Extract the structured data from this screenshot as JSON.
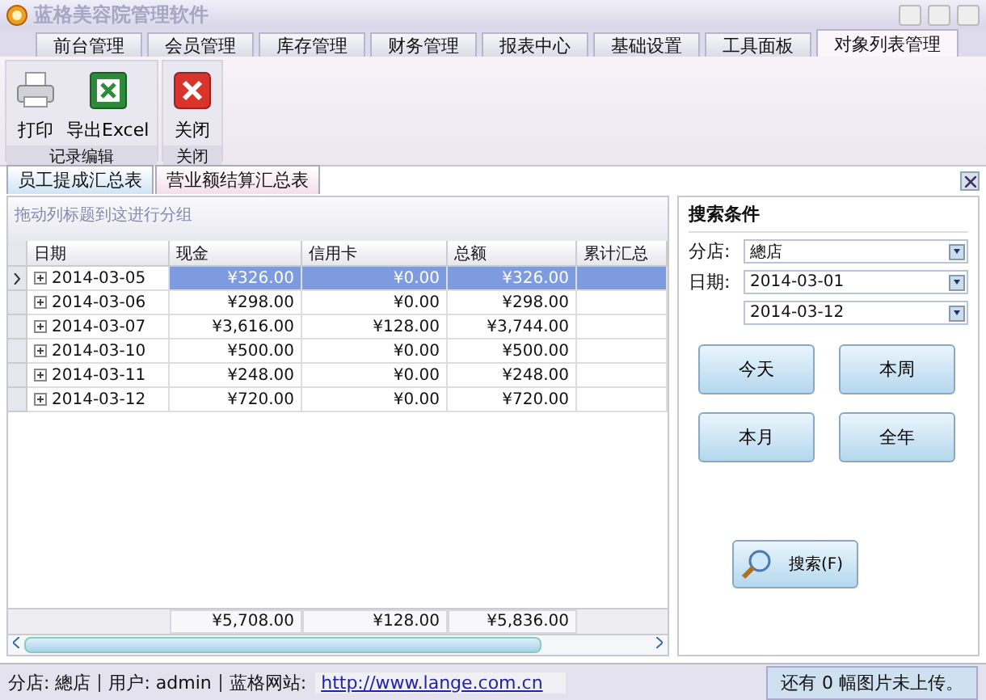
{
  "window": {
    "title": "蓝格美容院管理软件"
  },
  "menu_tabs": [
    {
      "label": "前台管理",
      "selected": false
    },
    {
      "label": "会员管理",
      "selected": false
    },
    {
      "label": "库存管理",
      "selected": false
    },
    {
      "label": "财务管理",
      "selected": false
    },
    {
      "label": "报表中心",
      "selected": false
    },
    {
      "label": "基础设置",
      "selected": false
    },
    {
      "label": "工具面板",
      "selected": false
    },
    {
      "label": "对象列表管理",
      "selected": true
    }
  ],
  "ribbon_groups": [
    {
      "label": "记录编辑",
      "buttons": [
        {
          "label": "打印",
          "kind": "print"
        },
        {
          "label": "导出Excel",
          "kind": "excel"
        }
      ]
    },
    {
      "label": "关闭",
      "buttons": [
        {
          "label": "关闭",
          "kind": "close"
        }
      ]
    }
  ],
  "doc_tabs": [
    {
      "label": "员工提成汇总表",
      "selected": false
    },
    {
      "label": "营业额结算汇总表",
      "selected": true
    }
  ],
  "group_panel": {
    "hint": "拖动列标题到这进行分组"
  },
  "table": {
    "columns": [
      "日期",
      "现金",
      "信用卡",
      "总额",
      "累计汇总"
    ],
    "rows": [
      {
        "cells": [
          "2014-03-05",
          "¥326.00",
          "¥0.00",
          "¥326.00",
          ""
        ],
        "selected": true
      },
      {
        "cells": [
          "2014-03-06",
          "¥298.00",
          "¥0.00",
          "¥298.00",
          ""
        ],
        "selected": false
      },
      {
        "cells": [
          "2014-03-07",
          "¥3,616.00",
          "¥128.00",
          "¥3,744.00",
          ""
        ],
        "selected": false
      },
      {
        "cells": [
          "2014-03-10",
          "¥500.00",
          "¥0.00",
          "¥500.00",
          ""
        ],
        "selected": false
      },
      {
        "cells": [
          "2014-03-11",
          "¥248.00",
          "¥0.00",
          "¥248.00",
          ""
        ],
        "selected": false
      },
      {
        "cells": [
          "2014-03-12",
          "¥720.00",
          "¥0.00",
          "¥720.00",
          ""
        ],
        "selected": false
      }
    ],
    "totals": [
      "¥5,708.00",
      "¥128.00",
      "¥5,836.00"
    ]
  },
  "search": {
    "title": "搜索条件",
    "store_label": "分店:",
    "store": "總店",
    "date_label": "日期:",
    "date_from": "2014-03-01",
    "date_to": "2014-03-12",
    "quick_buttons": [
      "今天",
      "本周",
      "本月",
      "全年"
    ],
    "search_button": "搜索(F)"
  },
  "status_bar": {
    "store": "分店: 總店",
    "user": "用户: admin",
    "site_label": "蓝格网站:",
    "site_url": "http://www.lange.com.cn",
    "upload": "还有 0 幅图片未上传。"
  }
}
